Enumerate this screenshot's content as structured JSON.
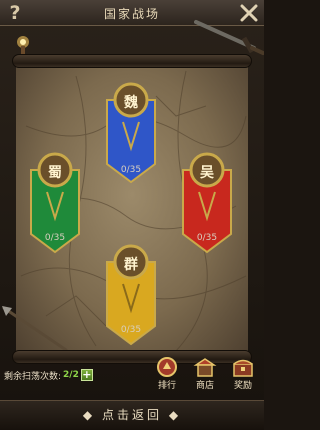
{
  "header": {
    "title": "国家战场",
    "help_label": "?"
  },
  "factions": [
    {
      "id": "wei",
      "char": "魏",
      "count": "0/35",
      "color": "#2f56c8",
      "trim": "#c9a94a"
    },
    {
      "id": "shu",
      "char": "蜀",
      "count": "0/35",
      "color": "#1f8a3a",
      "trim": "#c9a94a"
    },
    {
      "id": "wu",
      "char": "吴",
      "count": "0/35",
      "color": "#c8281e",
      "trim": "#c9a94a"
    },
    {
      "id": "qun",
      "char": "群",
      "count": "0/35",
      "color": "#d9a820",
      "trim": "#c9a94a"
    }
  ],
  "sweep": {
    "label": "剩余扫荡次数:",
    "value": "2/2",
    "plus": "+"
  },
  "buttons": {
    "rank": "排行",
    "shop": "商店",
    "reward": "奖励"
  },
  "footer": {
    "back": "点击返回",
    "left_arrow": "◆",
    "right_arrow": "◆"
  }
}
